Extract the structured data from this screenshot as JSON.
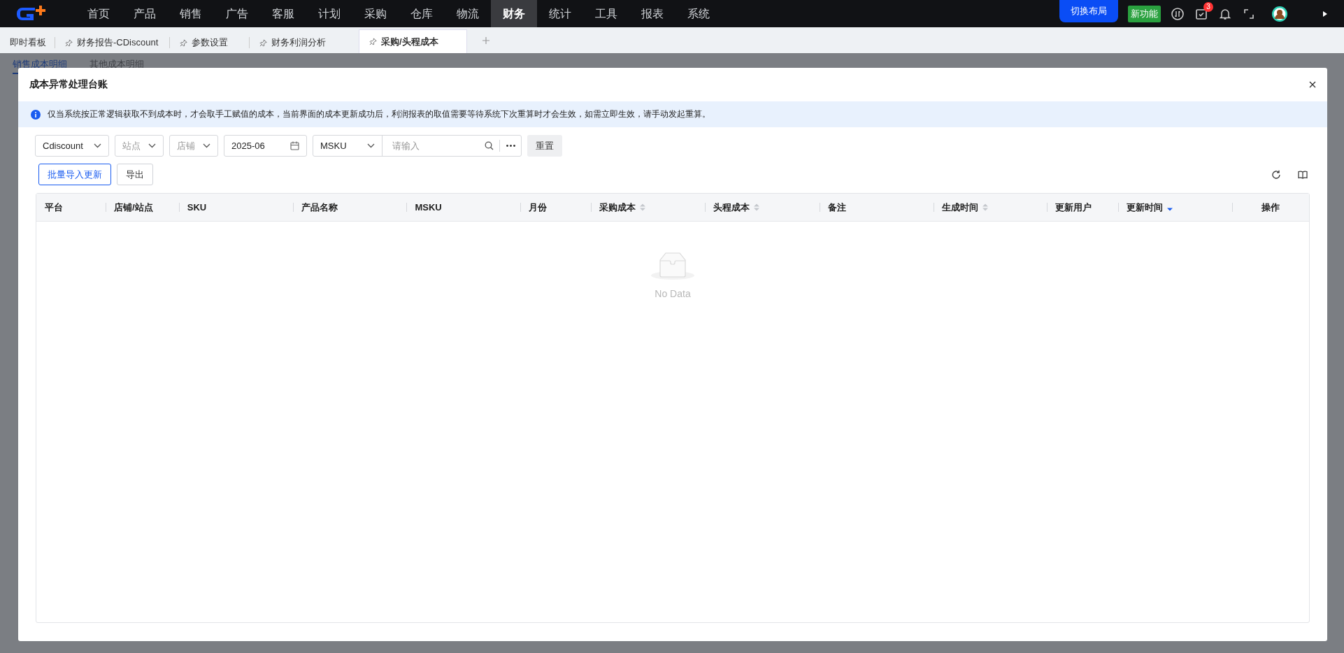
{
  "nav": {
    "items": [
      {
        "label": "首页",
        "selected": false
      },
      {
        "label": "产品",
        "selected": false
      },
      {
        "label": "销售",
        "selected": false
      },
      {
        "label": "广告",
        "selected": false
      },
      {
        "label": "客服",
        "selected": false
      },
      {
        "label": "计划",
        "selected": false
      },
      {
        "label": "采购",
        "selected": false
      },
      {
        "label": "仓库",
        "selected": false
      },
      {
        "label": "物流",
        "selected": false
      },
      {
        "label": "财务",
        "selected": true
      },
      {
        "label": "统计",
        "selected": false
      },
      {
        "label": "工具",
        "selected": false
      },
      {
        "label": "报表",
        "selected": false
      },
      {
        "label": "系统",
        "selected": false
      }
    ],
    "layout_button": "切换布局",
    "new_feature_badge": "新功能",
    "task_count": "3"
  },
  "tabs": [
    {
      "label": "即时看板",
      "pinned": false,
      "selected": false
    },
    {
      "label": "财务报告-CDiscount",
      "pinned": true,
      "selected": false
    },
    {
      "label": "参数设置",
      "pinned": true,
      "selected": false
    },
    {
      "label": "财务利润分析",
      "pinned": true,
      "selected": false
    },
    {
      "label": "采购/头程成本",
      "pinned": true,
      "selected": true
    }
  ],
  "sub_tabs": [
    {
      "label": "销售成本明细",
      "selected": true
    },
    {
      "label": "其他成本明细",
      "selected": false
    }
  ],
  "dialog": {
    "title": "成本异常处理台账",
    "notice": "仅当系统按正常逻辑获取不到成本时，才会取手工赋值的成本，当前界面的成本更新成功后，利润报表的取值需要等待系统下次重算时才会生效，如需立即生效，请手动发起重算。",
    "filters": {
      "platform": "Cdiscount",
      "site": {
        "placeholder": "站点"
      },
      "shop": {
        "placeholder": "店铺"
      },
      "month": "2025-06",
      "search_field": "MSKU",
      "search": {
        "placeholder": "请输入"
      },
      "reset": "重置"
    },
    "actions": [
      "批量导入更新",
      "导出"
    ],
    "table": {
      "columns": [
        {
          "label": "平台",
          "kind": "plain"
        },
        {
          "label": "店铺/站点",
          "kind": "plain"
        },
        {
          "label": "SKU",
          "kind": "plain"
        },
        {
          "label": "产品名称",
          "kind": "plain"
        },
        {
          "label": "MSKU",
          "kind": "plain"
        },
        {
          "label": "月份",
          "kind": "plain"
        },
        {
          "label": "采购成本",
          "kind": "sortable",
          "sorted_descending": false
        },
        {
          "label": "头程成本",
          "kind": "sortable",
          "sorted_descending": false
        },
        {
          "label": "备注",
          "kind": "plain"
        },
        {
          "label": "生成时间",
          "kind": "sortable",
          "sorted_descending": false
        },
        {
          "label": "更新用户",
          "kind": "plain"
        },
        {
          "label": "更新时间",
          "kind": "sortable",
          "sorted_descending": true
        },
        {
          "label": "操作",
          "kind": "plain"
        }
      ],
      "empty_text": "No Data"
    }
  }
}
